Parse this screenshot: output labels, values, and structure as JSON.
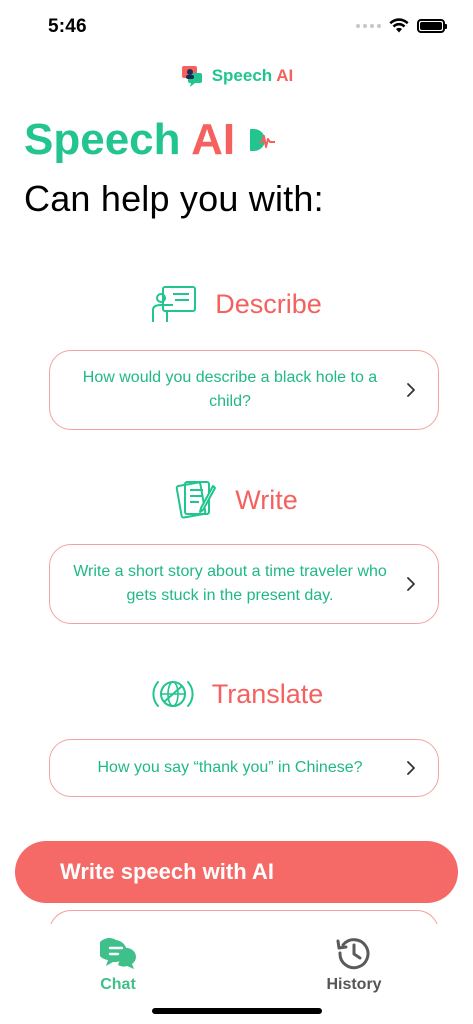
{
  "status_bar": {
    "time": "5:46"
  },
  "brand": {
    "word1": "Speech",
    "word2": "AI"
  },
  "hero": {
    "word1": "Speech",
    "word2": "AI",
    "subtitle": "Can help you with:"
  },
  "sections": [
    {
      "label": "Describe",
      "prompt": "How would you describe a black hole to a child?",
      "icon": "presentation-icon"
    },
    {
      "label": "Write",
      "prompt": "Write a short story about a time traveler who gets stuck in the present day.",
      "icon": "write-document-icon"
    },
    {
      "label": "Translate",
      "prompt": "How you say “thank you” in Chinese?",
      "icon": "translate-globe-icon"
    }
  ],
  "cta": {
    "label": "Write speech with AI"
  },
  "tabs": [
    {
      "label": "Chat",
      "icon": "chat-bubbles-icon",
      "active": true
    },
    {
      "label": "History",
      "icon": "history-clock-icon",
      "active": false
    }
  ],
  "colors": {
    "green": "#22c48f",
    "red": "#f4615e",
    "card_border": "#f3a2a0",
    "cta": "#f56966",
    "inactive": "#555555"
  }
}
